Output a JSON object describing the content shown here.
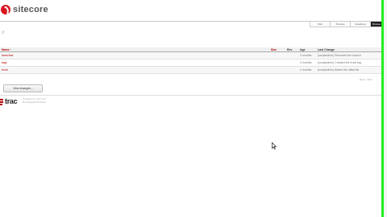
{
  "logo": {
    "text": "sitecore"
  },
  "nav": {
    "items": [
      "Wiki",
      "Timeline",
      "Roadmap",
      "Browse"
    ]
  },
  "path": {
    "text": ":/"
  },
  "table": {
    "headers": {
      "name": "Name ↑",
      "size": "Size",
      "rev": "Rev",
      "age": "Age",
      "last_change": "Last Change"
    },
    "rows": [
      {
        "name": "branches",
        "rev": "",
        "age": "3 months",
        "last_change": "(scriptadmin) Removed the branch"
      },
      {
        "name": "tags",
        "rev": "",
        "age": "3 months",
        "last_change": "(scriptadmin) Created the trunk tag"
      },
      {
        "name": "trunk",
        "rev": "",
        "age": "2 months",
        "last_change": "(scriptadmin) Added the initial file"
      }
    ]
  },
  "footer_links": {
    "text": "Note: | Trac"
  },
  "view_changes_button": {
    "label": "View changes..."
  },
  "trac_logo": {
    "text": "trac"
  },
  "powered_by": {
    "line1": "Powered by Trac 0.11",
    "line2": "By Edgewall Software"
  },
  "colors": {
    "brand_red": "#d9161e",
    "link_red": "#b00000",
    "green_accent": "#22ee22"
  }
}
